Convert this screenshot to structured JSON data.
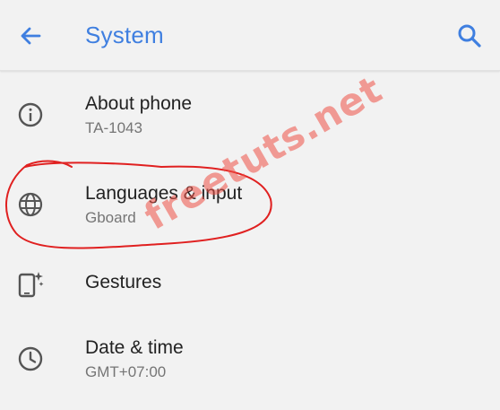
{
  "appbar": {
    "title": "System",
    "accent_color": "#3f7fe0",
    "back_icon": "arrow-left-icon",
    "search_icon": "search-icon"
  },
  "settings_items": [
    {
      "icon": "info-icon",
      "title": "About phone",
      "subtitle": "TA-1043"
    },
    {
      "icon": "globe-icon",
      "title": "Languages & input",
      "subtitle": "Gboard"
    },
    {
      "icon": "gestures-phone-icon",
      "title": "Gestures",
      "subtitle": ""
    },
    {
      "icon": "clock-icon",
      "title": "Date & time",
      "subtitle": "GMT+07:00"
    }
  ],
  "annotation": {
    "highlight_color": "#e02020",
    "highlighted_item": "Languages & input"
  },
  "watermark": {
    "text": "freetuts.net",
    "color": "#ee5046"
  }
}
